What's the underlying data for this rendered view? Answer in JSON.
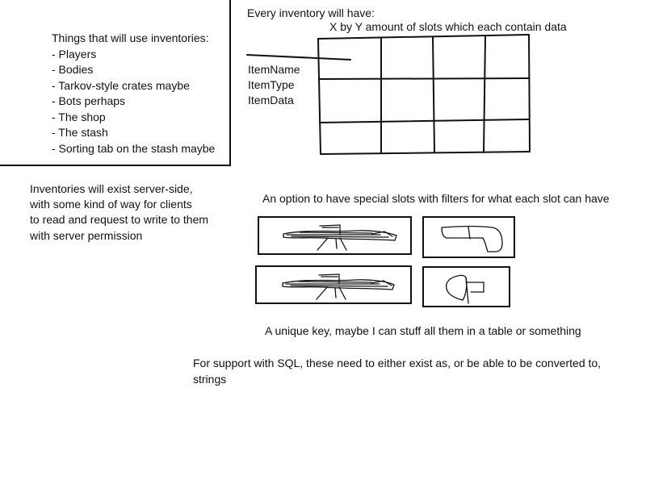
{
  "uses_box": {
    "title": "Things that will use inventories:",
    "items": [
      "- Players",
      "- Bodies",
      "- Tarkov-style crates maybe",
      "- Bots perhaps",
      "- The shop",
      "- The stash",
      "- Sorting tab on the stash maybe"
    ]
  },
  "inventory": {
    "heading": "Every inventory will have:",
    "grid_caption": "X by Y amount of slots which each contain data",
    "fields": [
      "ItemName",
      "ItemType",
      "ItemData"
    ],
    "grid": {
      "columns": 4,
      "rows": 3
    }
  },
  "server_note": {
    "lines": [
      "Inventories will exist server-side,",
      "with some kind of way for clients",
      "to read and request to write to them",
      "with server permission"
    ]
  },
  "special_slots": {
    "caption": "An option to have special slots with filters for what each slot can have",
    "slots": [
      {
        "icon": "rifle-sketch-icon"
      },
      {
        "icon": "pistol-sketch-icon"
      },
      {
        "icon": "rifle-sketch-icon"
      },
      {
        "icon": "armor-sketch-icon"
      }
    ]
  },
  "unique_key_note": "A unique key, maybe I can stuff all them in a table or something",
  "sql_note": {
    "lines": [
      "For support with SQL, these need to either exist as, or be able to be converted to,",
      "strings"
    ]
  }
}
